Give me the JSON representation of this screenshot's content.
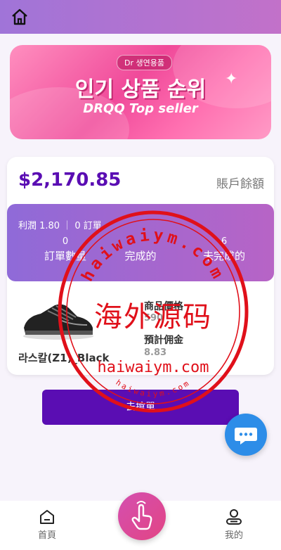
{
  "banner": {
    "brand": "Dr 생연용품",
    "title": "인기 상품 순위",
    "subtitle": "DRQQ Top seller"
  },
  "account": {
    "balance": "$2,170.85",
    "balance_label": "賬戶餘額"
  },
  "stats": {
    "profit_line": "利潤 1.80 ｜ 0 訂單",
    "columns": [
      {
        "value": "0",
        "label": "訂單數量"
      },
      {
        "value": "",
        "label": "完成的"
      },
      {
        "value": "6",
        "label": "未完成的"
      }
    ]
  },
  "product": {
    "name": "라스칼(Z1)_Black",
    "price_label": "商品價格",
    "price_value": "590",
    "commission_label": "預計佣金",
    "commission_value": "8.83"
  },
  "actions": {
    "order_label": "去搶單"
  },
  "tabs": [
    {
      "label": "首頁",
      "icon": "home-icon"
    },
    {
      "label": "我的",
      "icon": "user-icon"
    }
  ],
  "watermark": {
    "text_main": "海外源码",
    "text_url": "haiwaiym.com",
    "color": "#e0101a"
  },
  "colors": {
    "accent": "#5a0db3",
    "chat": "#2d8de8"
  }
}
